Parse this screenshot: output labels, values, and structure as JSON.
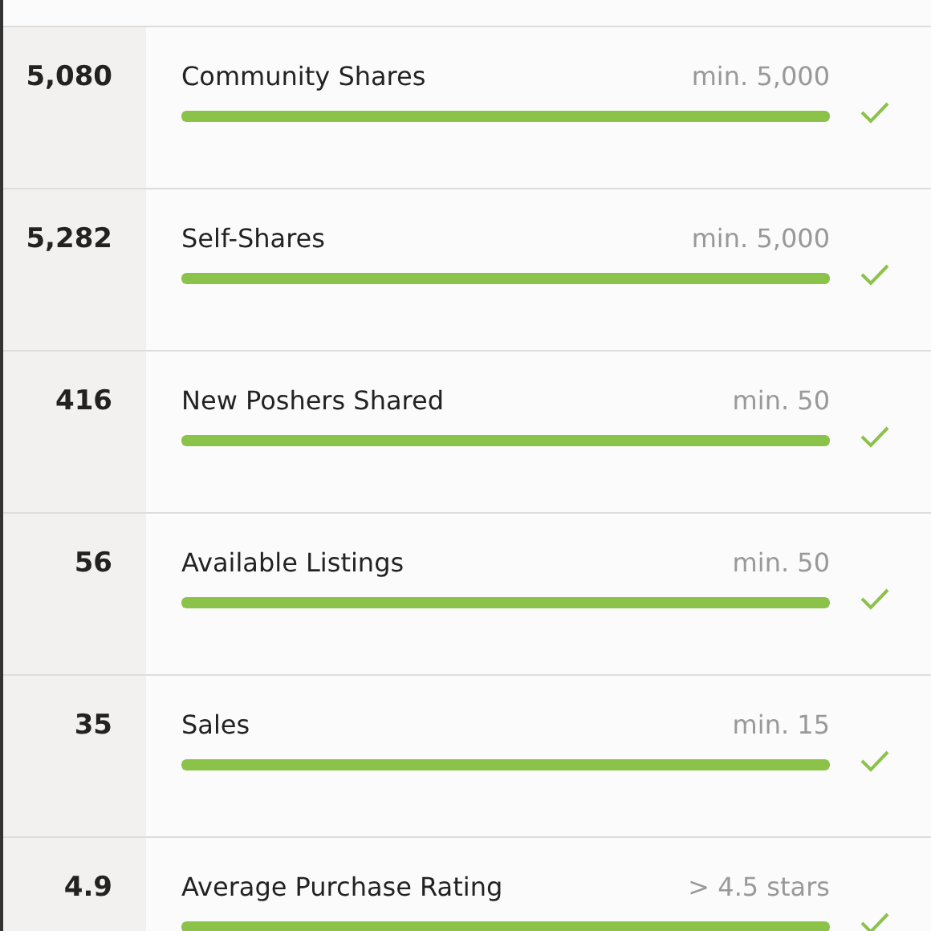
{
  "requirements": [
    {
      "value": "5,080",
      "label": "Community Shares",
      "minimum": "min. 5,000",
      "level": 1,
      "met": true
    },
    {
      "value": "5,282",
      "label": "Self-Shares",
      "minimum": "min. 5,000",
      "level": 1,
      "met": true
    },
    {
      "value": "416",
      "label": "New Poshers Shared",
      "minimum": "min. 50",
      "level": 1,
      "met": true
    },
    {
      "value": "56",
      "label": "Available Listings",
      "minimum": "min. 50",
      "level": 1,
      "met": true
    },
    {
      "value": "35",
      "label": "Sales",
      "minimum": "min. 15",
      "level": 1,
      "met": true
    },
    {
      "value": "4.9",
      "label": "Average Purchase Rating",
      "minimum": "> 4.5 stars",
      "level": 1,
      "met": true
    }
  ]
}
